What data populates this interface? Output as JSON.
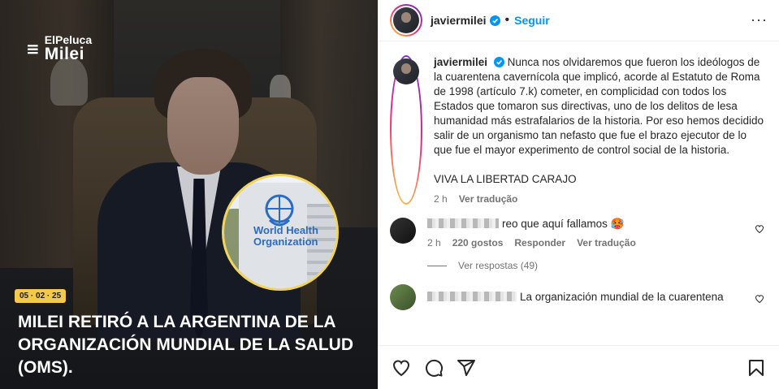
{
  "image": {
    "logo_top": "ElPeluca",
    "logo_bottom": "Milei",
    "who_line1": "World Health",
    "who_line2": "Organization",
    "date_tag": "05 · 02 · 25",
    "headline": "MILEI RETIRÓ A LA ARGENTINA DE LA ORGANIZACIÓN MUNDIAL DE LA SALUD (OMS)."
  },
  "header": {
    "username": "javiermilei",
    "dot": "•",
    "follow_label": "Seguir",
    "more_label": "···"
  },
  "caption": {
    "username": "javiermilei",
    "text": "Nunca nos olvidaremos que fueron los ideólogos de la cuarentena cavernícola que implicó, acorde al Estatuto de Roma de 1998 (artículo 7.k) cometer, en complicidad con todos los Estados que tomaron sus directivas, uno de los delitos de lesa humanidad más estrafalarios de la historia. Por eso hemos decidido salir de un organismo tan nefasto que fue el brazo ejecutor de lo que fue el mayor experimento de control social de la historia.",
    "closing": "VIVA LA LIBERTAD CARAJO",
    "time": "2 h",
    "translate": "Ver tradução"
  },
  "comments": [
    {
      "text": "reo que aquí fallamos 🥵",
      "time": "2 h",
      "likes": "220 gostos",
      "reply": "Responder",
      "translate": "Ver tradução",
      "view_replies": "Ver respostas (49)"
    },
    {
      "text": "La organización mundial de la cuarentena"
    }
  ],
  "colors": {
    "accent": "#0095f6",
    "tag": "#f2c94c",
    "who_blue": "#2a6cc4"
  }
}
